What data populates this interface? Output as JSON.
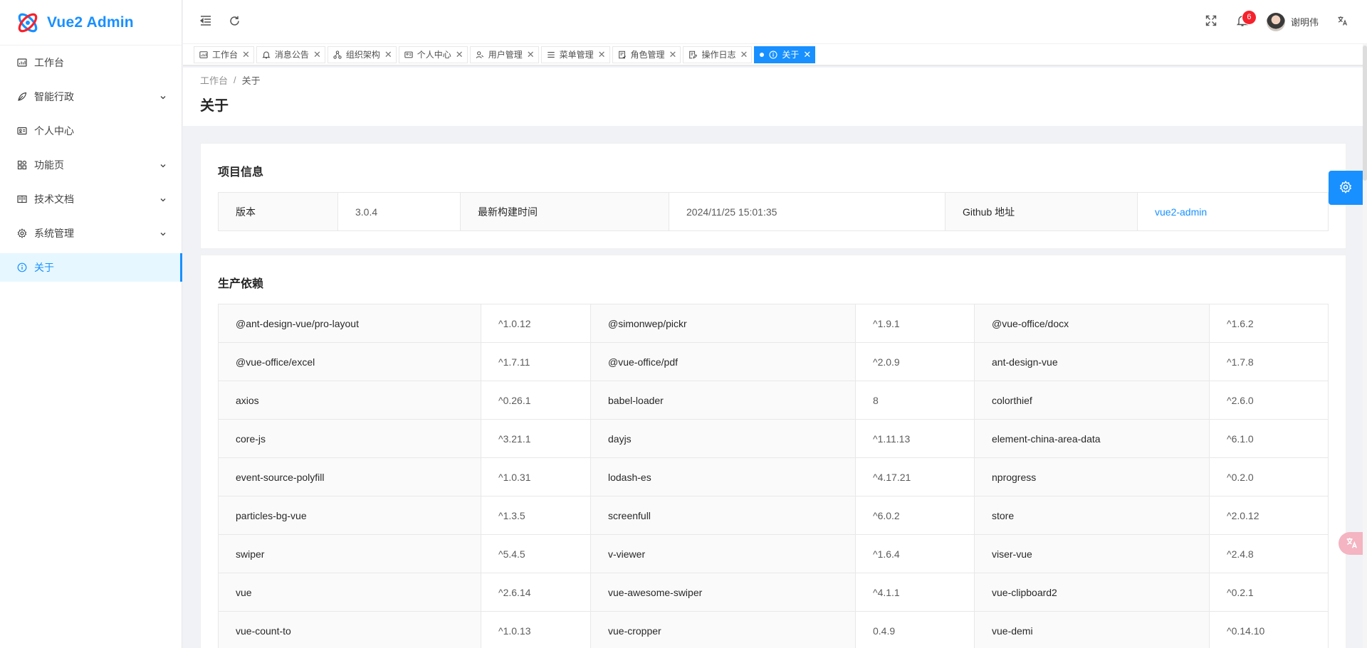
{
  "app": {
    "title": "Vue2 Admin"
  },
  "sidebar": {
    "items": [
      {
        "label": "工作台",
        "icon": "dashboard-icon",
        "has_children": false
      },
      {
        "label": "智能行政",
        "icon": "leaf-icon",
        "has_children": true
      },
      {
        "label": "个人中心",
        "icon": "id-card-icon",
        "has_children": false
      },
      {
        "label": "功能页",
        "icon": "appstore-icon",
        "has_children": true
      },
      {
        "label": "技术文档",
        "icon": "book-icon",
        "has_children": true
      },
      {
        "label": "系统管理",
        "icon": "gear-icon",
        "has_children": true
      },
      {
        "label": "关于",
        "icon": "info-circle-icon",
        "has_children": false,
        "active": true
      }
    ]
  },
  "header": {
    "notification_count": "6",
    "username": "谢明伟"
  },
  "tabs": [
    {
      "label": "工作台",
      "icon": "dashboard-icon"
    },
    {
      "label": "消息公告",
      "icon": "bell-icon"
    },
    {
      "label": "组织架构",
      "icon": "cluster-icon"
    },
    {
      "label": "个人中心",
      "icon": "id-card-icon"
    },
    {
      "label": "用户管理",
      "icon": "user-icon"
    },
    {
      "label": "菜单管理",
      "icon": "menu-icon"
    },
    {
      "label": "角色管理",
      "icon": "solution-icon"
    },
    {
      "label": "操作日志",
      "icon": "file-edit-icon"
    },
    {
      "label": "关于",
      "icon": "info-circle-icon",
      "active": true
    }
  ],
  "breadcrumb": {
    "home": "工作台",
    "sep": "/",
    "current": "关于"
  },
  "page_title": "关于",
  "project_info": {
    "title": "项目信息",
    "version_label": "版本",
    "version": "3.0.4",
    "build_label": "最新构建时间",
    "build_time": "2024/11/25 15:01:35",
    "github_label": "Github 地址",
    "github_link": "vue2-admin"
  },
  "dependencies": {
    "title": "生产依赖",
    "rows": [
      [
        [
          "@ant-design-vue/pro-layout",
          "^1.0.12"
        ],
        [
          "@simonwep/pickr",
          "^1.9.1"
        ],
        [
          "@vue-office/docx",
          "^1.6.2"
        ]
      ],
      [
        [
          "@vue-office/excel",
          "^1.7.11"
        ],
        [
          "@vue-office/pdf",
          "^2.0.9"
        ],
        [
          "ant-design-vue",
          "^1.7.8"
        ]
      ],
      [
        [
          "axios",
          "^0.26.1"
        ],
        [
          "babel-loader",
          "8"
        ],
        [
          "colorthief",
          "^2.6.0"
        ]
      ],
      [
        [
          "core-js",
          "^3.21.1"
        ],
        [
          "dayjs",
          "^1.11.13"
        ],
        [
          "element-china-area-data",
          "^6.1.0"
        ]
      ],
      [
        [
          "event-source-polyfill",
          "^1.0.31"
        ],
        [
          "lodash-es",
          "^4.17.21"
        ],
        [
          "nprogress",
          "^0.2.0"
        ]
      ],
      [
        [
          "particles-bg-vue",
          "^1.3.5"
        ],
        [
          "screenfull",
          "^6.0.2"
        ],
        [
          "store",
          "^2.0.12"
        ]
      ],
      [
        [
          "swiper",
          "^5.4.5"
        ],
        [
          "v-viewer",
          "^1.6.4"
        ],
        [
          "viser-vue",
          "^2.4.8"
        ]
      ],
      [
        [
          "vue",
          "^2.6.14"
        ],
        [
          "vue-awesome-swiper",
          "^4.1.1"
        ],
        [
          "vue-clipboard2",
          "^0.2.1"
        ]
      ],
      [
        [
          "vue-count-to",
          "^1.0.13"
        ],
        [
          "vue-cropper",
          "0.4.9"
        ],
        [
          "vue-demi",
          "^0.14.10"
        ]
      ]
    ]
  },
  "colors": {
    "primary": "#1890ff",
    "badge": "#f5222d",
    "active_bg": "#e6f7ff"
  }
}
